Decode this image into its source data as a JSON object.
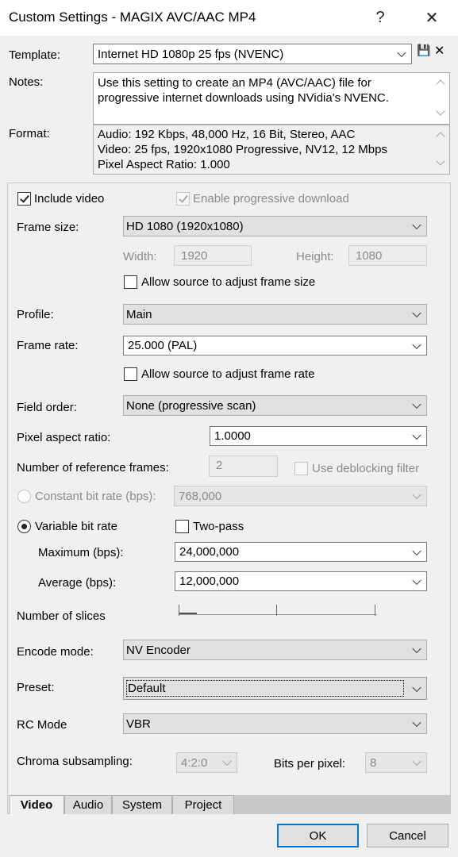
{
  "window": {
    "title": "Custom Settings - MAGIX AVC/AAC MP4",
    "help_glyph": "?",
    "close_glyph": "✕"
  },
  "template": {
    "label": "Template:",
    "value": "Internet HD 1080p 25 fps (NVENC)",
    "save_icon": "💾",
    "delete_icon": "✕"
  },
  "notes": {
    "label": "Notes:",
    "text": "Use this setting to create an MP4 (AVC/AAC) file for progressive internet downloads using NVidia's NVENC."
  },
  "format": {
    "label": "Format:",
    "lines": [
      "Audio: 192 Kbps, 48,000 Hz, 16 Bit, Stereo, AAC",
      "Video: 25 fps, 1920x1080 Progressive, NV12, 12 Mbps",
      "Pixel Aspect Ratio: 1.000"
    ]
  },
  "video": {
    "include_video": {
      "label": "Include video",
      "checked": true
    },
    "progressive_download": {
      "label": "Enable progressive download",
      "checked": true
    },
    "frame_size": {
      "label": "Frame size:",
      "value": "HD 1080 (1920x1080)"
    },
    "width": {
      "label": "Width:",
      "value": "1920"
    },
    "height": {
      "label": "Height:",
      "value": "1080"
    },
    "allow_frame_size": {
      "label": "Allow source to adjust frame size",
      "checked": false
    },
    "profile": {
      "label": "Profile:",
      "value": "Main"
    },
    "frame_rate": {
      "label": "Frame rate:",
      "value": "25.000 (PAL)"
    },
    "allow_frame_rate": {
      "label": "Allow source to adjust frame rate",
      "checked": false
    },
    "field_order": {
      "label": "Field order:",
      "value": "None (progressive scan)"
    },
    "pixel_aspect": {
      "label": "Pixel aspect ratio:",
      "value": "1.0000"
    },
    "ref_frames": {
      "label": "Number of reference frames:",
      "value": "2"
    },
    "deblocking": {
      "label": "Use deblocking filter",
      "checked": false
    },
    "cbr": {
      "label": "Constant bit rate (bps):",
      "value": "768,000",
      "selected": false
    },
    "vbr": {
      "label": "Variable bit rate",
      "selected": true
    },
    "two_pass": {
      "label": "Two-pass",
      "checked": false
    },
    "maximum": {
      "label": "Maximum (bps):",
      "value": "24,000,000"
    },
    "average": {
      "label": "Average (bps):",
      "value": "12,000,000"
    },
    "slices": {
      "label": "Number of slices",
      "level": 0
    },
    "encode_mode": {
      "label": "Encode mode:",
      "value": "NV Encoder"
    },
    "preset": {
      "label": "Preset:",
      "value": "Default"
    },
    "rc_mode": {
      "label": "RC Mode",
      "value": "VBR"
    },
    "chroma": {
      "label": "Chroma subsampling:",
      "value": "4:2:0"
    },
    "bits_per_pixel": {
      "label": "Bits per pixel:",
      "value": "8"
    }
  },
  "tabs": [
    {
      "label": "Video",
      "active": true
    },
    {
      "label": "Audio",
      "active": false
    },
    {
      "label": "System",
      "active": false
    },
    {
      "label": "Project",
      "active": false
    }
  ],
  "buttons": {
    "ok": "OK",
    "cancel": "Cancel"
  }
}
